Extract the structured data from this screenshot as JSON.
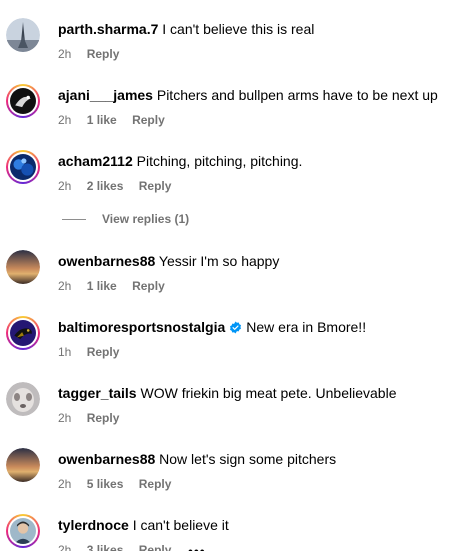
{
  "comments": [
    {
      "username": "parth.sharma.7",
      "text": "I can't believe this is real",
      "time": "2h",
      "likes": "",
      "reply": "Reply",
      "avatar_icon": "eiffel-tower-photo-avatar"
    },
    {
      "username": "ajani___james",
      "text": "Pitchers and bullpen arms have to be next up",
      "time": "2h",
      "likes": "1 like",
      "reply": "Reply",
      "avatar_icon": "dark-logo-avatar"
    },
    {
      "username": "acham2112",
      "text": "Pitching, pitching, pitching.",
      "time": "2h",
      "likes": "2 likes",
      "reply": "Reply",
      "avatar_icon": "blue-abstract-avatar"
    },
    {
      "username": "owenbarnes88",
      "text": "Yessir I'm so happy",
      "time": "2h",
      "likes": "1 like",
      "reply": "Reply",
      "avatar_icon": "sunset-photo-avatar"
    },
    {
      "username": "baltimoresportsnostalgia",
      "text": "New era in Bmore!!",
      "time": "1h",
      "likes": "",
      "reply": "Reply",
      "avatar_icon": "ravens-logo-avatar",
      "verified": true
    },
    {
      "username": "tagger_tails",
      "text": "WOW friekin big meat pete. Unbelievable",
      "time": "2h",
      "likes": "",
      "reply": "Reply",
      "avatar_icon": "dog-photo-avatar"
    },
    {
      "username": "owenbarnes88",
      "text": "Now let's sign some pitchers",
      "time": "2h",
      "likes": "5 likes",
      "reply": "Reply",
      "avatar_icon": "sunset-photo-avatar"
    },
    {
      "username": "tylerdnoce",
      "text": "I can't believe it",
      "time": "2h",
      "likes": "3 likes",
      "reply": "Reply",
      "avatar_icon": "person-photo-avatar"
    }
  ],
  "view_replies_label": "View replies (1)",
  "more_label": "•••",
  "colors": {
    "meta": "#737373",
    "verified": "#0095f6"
  }
}
